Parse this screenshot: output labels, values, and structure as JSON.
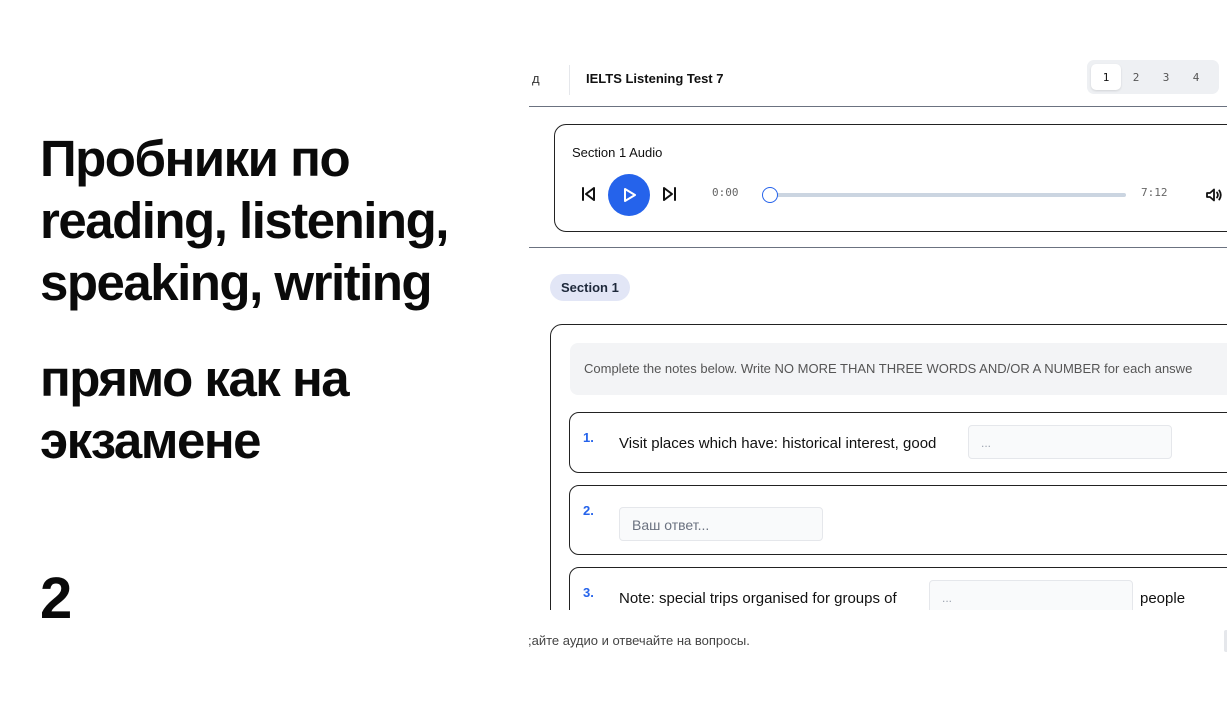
{
  "promo": {
    "title": "Пробники по reading, listening, speaking, writing",
    "subtitle": "прямо как на экзамене",
    "slide_number": "2"
  },
  "header": {
    "back_fragment": "д",
    "test_title": "IELTS Listening Test 7",
    "section_tabs": [
      "1",
      "2",
      "3",
      "4"
    ],
    "active_tab": "1"
  },
  "player": {
    "title": "Section 1 Audio",
    "current_time": "0:00",
    "total_time": "7:12",
    "progress": 0,
    "accent_color": "#2563eb",
    "icons": {
      "prev": "skip-back-icon",
      "play": "play-icon",
      "next": "skip-forward-icon",
      "volume": "volume-icon"
    }
  },
  "section_badge": "Section 1",
  "instructions": "Complete the notes below. Write NO MORE THAN THREE WORDS AND/OR A NUMBER for each answe",
  "questions": [
    {
      "number": "1.",
      "text": "Visit places which have: historical interest, good",
      "placeholder": "...",
      "suffix": ""
    },
    {
      "number": "2.",
      "text": "",
      "placeholder": "Ваш ответ...",
      "suffix": ""
    },
    {
      "number": "3.",
      "text": "Note: special trips organised for groups of",
      "placeholder": "...",
      "suffix": "people"
    }
  ],
  "footer_note": ";айте аудио и отвечайте на вопросы."
}
